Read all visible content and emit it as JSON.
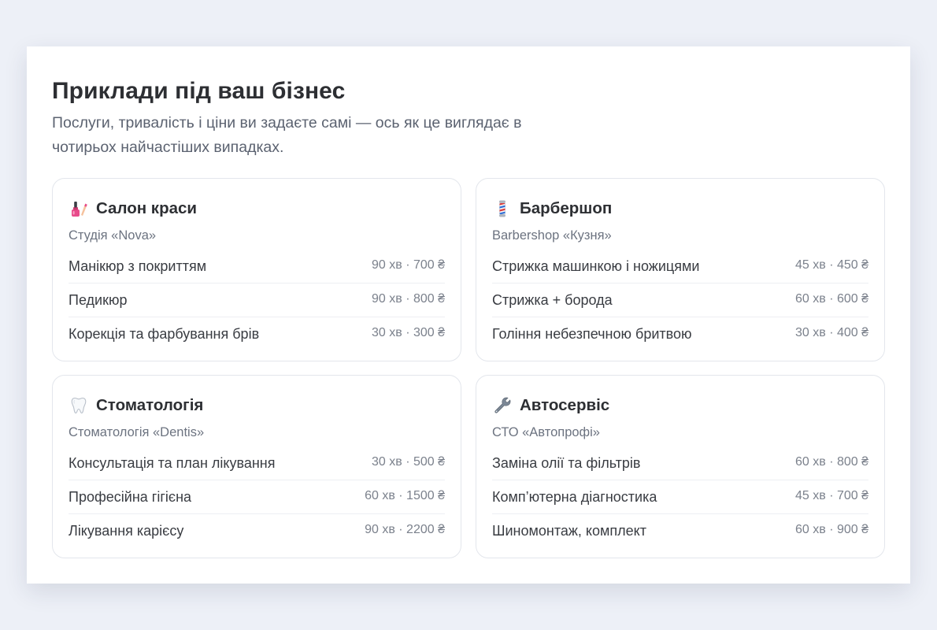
{
  "header": {
    "title": "Приклади під ваш бізнес",
    "subtitle": "Послуги, тривалість і ціни ви задаєте самі — ось як це виглядає в чотирьох найчастіших випадках."
  },
  "cards": [
    {
      "icon": "nail-polish-icon",
      "title": "Салон краси",
      "business": "Студія «Nova»",
      "services": [
        {
          "name": "Манікюр з покриттям",
          "meta": "90 хв · 700 ₴"
        },
        {
          "name": "Педикюр",
          "meta": "90 хв · 800 ₴"
        },
        {
          "name": "Корекція та фарбування брів",
          "meta": "30 хв · 300 ₴"
        }
      ]
    },
    {
      "icon": "barber-pole-icon",
      "title": "Барбершоп",
      "business": "Barbershop «Кузня»",
      "services": [
        {
          "name": "Стрижка машинкою і ножицями",
          "meta": "45 хв · 450 ₴"
        },
        {
          "name": "Стрижка + борода",
          "meta": "60 хв · 600 ₴"
        },
        {
          "name": "Гоління небезпечною бритвою",
          "meta": "30 хв · 400 ₴"
        }
      ]
    },
    {
      "icon": "tooth-icon",
      "title": "Стоматологія",
      "business": "Стоматологія «Dentis»",
      "services": [
        {
          "name": "Консультація та план лікування",
          "meta": "30 хв · 500 ₴"
        },
        {
          "name": "Професійна гігієна",
          "meta": "60 хв · 1500 ₴"
        },
        {
          "name": "Лікування карієсу",
          "meta": "90 хв · 2200 ₴"
        }
      ]
    },
    {
      "icon": "wrench-icon",
      "title": "Автосервіс",
      "business": "СТО «Автопрофі»",
      "services": [
        {
          "name": "Заміна олії та фільтрів",
          "meta": "60 хв · 800 ₴"
        },
        {
          "name": "Комп’ютерна діагностика",
          "meta": "45 хв · 700 ₴"
        },
        {
          "name": "Шиномонтаж, комплект",
          "meta": "60 хв · 900 ₴"
        }
      ]
    }
  ]
}
